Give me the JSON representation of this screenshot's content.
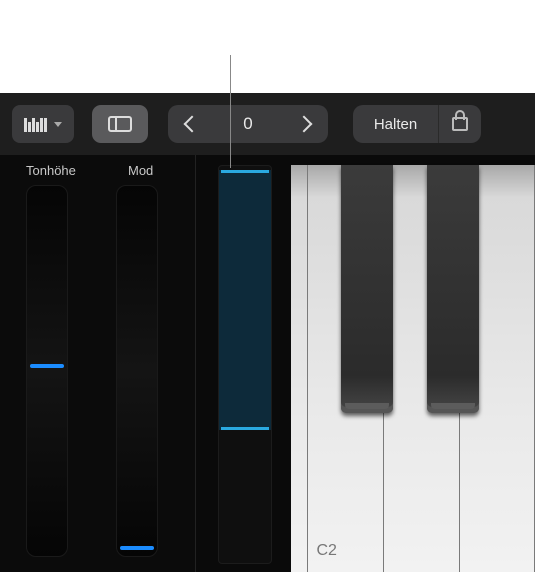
{
  "toolbar": {
    "keyboard_select_icon": "keyboard-icon",
    "layout_icon": "sidebar-layout-icon",
    "octave_value": "0",
    "hold_label": "Halten",
    "lock_icon": "lock-icon"
  },
  "controls": {
    "pitch_label": "Tonhöhe",
    "mod_label": "Mod",
    "pitch_value": 0.5,
    "mod_value": 0.0,
    "velocity_top": 0.02,
    "velocity_bottom": 0.66
  },
  "keyboard": {
    "note_label": "C2"
  }
}
